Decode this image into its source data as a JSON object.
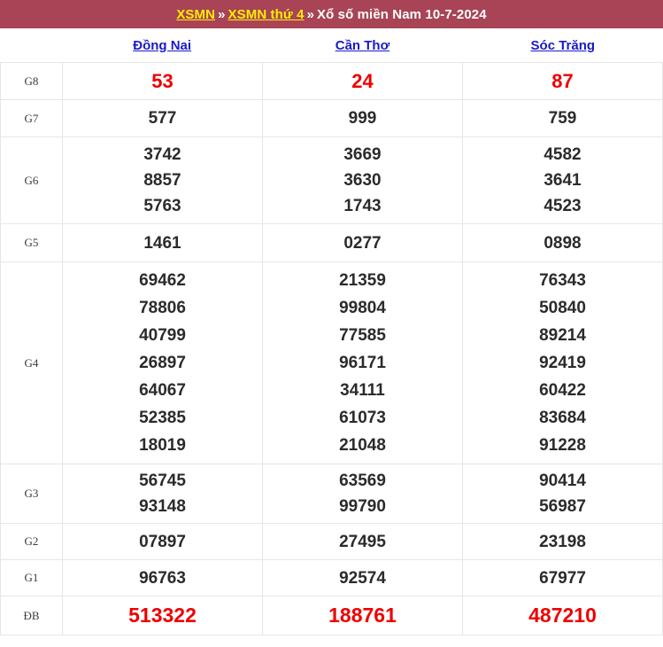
{
  "header": {
    "breadcrumb": [
      {
        "text": "XSMN",
        "type": "link"
      },
      {
        "text": "»",
        "type": "separator"
      },
      {
        "text": "XSMN thứ 4",
        "type": "link"
      },
      {
        "text": "»",
        "type": "separator"
      },
      {
        "text": "Xổ số miền Nam 10-7-2024",
        "type": "plain"
      }
    ],
    "link1": "XSMN",
    "sep1": "»",
    "link2": "XSMN thứ 4",
    "sep2": "»",
    "title": "Xổ số miền Nam 10-7-2024",
    "background_color": "#a84455",
    "link_color": "#ffee00",
    "text_color": "#ffffff"
  },
  "columns": [
    {
      "name": "Đồng Nai",
      "link_color": "#1a1ac8"
    },
    {
      "name": "Cần Thơ",
      "link_color": "#1a1ac8"
    },
    {
      "name": "Sóc Trăng",
      "link_color": "#1a1ac8"
    }
  ],
  "column_labels": {
    "c0": "Đồng Nai",
    "c1": "Cần Thơ",
    "c2": "Sóc Trăng"
  },
  "prize_rows": [
    {
      "label": "G8",
      "highlight": true,
      "color": "#ee0000",
      "dong_nai": [
        "53"
      ],
      "can_tho": [
        "24"
      ],
      "soc_trang": [
        "87"
      ]
    },
    {
      "label": "G7",
      "highlight": false,
      "dong_nai": [
        "577"
      ],
      "can_tho": [
        "999"
      ],
      "soc_trang": [
        "759"
      ]
    },
    {
      "label": "G6",
      "highlight": false,
      "dong_nai": [
        "3742",
        "8857",
        "5763"
      ],
      "can_tho": [
        "3669",
        "3630",
        "1743"
      ],
      "soc_trang": [
        "4582",
        "3641",
        "4523"
      ]
    },
    {
      "label": "G5",
      "highlight": false,
      "dong_nai": [
        "1461"
      ],
      "can_tho": [
        "0277"
      ],
      "soc_trang": [
        "0898"
      ]
    },
    {
      "label": "G4",
      "highlight": false,
      "dong_nai": [
        "69462",
        "78806",
        "40799",
        "26897",
        "64067",
        "52385",
        "18019"
      ],
      "can_tho": [
        "21359",
        "99804",
        "77585",
        "96171",
        "34111",
        "61073",
        "21048"
      ],
      "soc_trang": [
        "76343",
        "50840",
        "89214",
        "92419",
        "60422",
        "83684",
        "91228"
      ]
    },
    {
      "label": "G3",
      "highlight": false,
      "dong_nai": [
        "56745",
        "93148"
      ],
      "can_tho": [
        "63569",
        "99790"
      ],
      "soc_trang": [
        "90414",
        "56987"
      ]
    },
    {
      "label": "G2",
      "highlight": false,
      "dong_nai": [
        "07897"
      ],
      "can_tho": [
        "27495"
      ],
      "soc_trang": [
        "23198"
      ]
    },
    {
      "label": "G1",
      "highlight": false,
      "dong_nai": [
        "96763"
      ],
      "can_tho": [
        "92574"
      ],
      "soc_trang": [
        "67977"
      ]
    },
    {
      "label": "ĐB",
      "highlight": true,
      "color": "#ee0000",
      "dong_nai": [
        "513322"
      ],
      "can_tho": [
        "188761"
      ],
      "soc_trang": [
        "487210"
      ]
    }
  ],
  "cells": {
    "g8": {
      "label": "G8",
      "c0": "53",
      "c1": "24",
      "c2": "87"
    },
    "g7": {
      "label": "G7",
      "c0": "577",
      "c1": "999",
      "c2": "759"
    },
    "g6": {
      "label": "G6",
      "c0_0": "3742",
      "c0_1": "8857",
      "c0_2": "5763",
      "c1_0": "3669",
      "c1_1": "3630",
      "c1_2": "1743",
      "c2_0": "4582",
      "c2_1": "3641",
      "c2_2": "4523"
    },
    "g5": {
      "label": "G5",
      "c0": "1461",
      "c1": "0277",
      "c2": "0898"
    },
    "g4": {
      "label": "G4",
      "c0_0": "69462",
      "c0_1": "78806",
      "c0_2": "40799",
      "c0_3": "26897",
      "c0_4": "64067",
      "c0_5": "52385",
      "c0_6": "18019",
      "c1_0": "21359",
      "c1_1": "99804",
      "c1_2": "77585",
      "c1_3": "96171",
      "c1_4": "34111",
      "c1_5": "61073",
      "c1_6": "21048",
      "c2_0": "76343",
      "c2_1": "50840",
      "c2_2": "89214",
      "c2_3": "92419",
      "c2_4": "60422",
      "c2_5": "83684",
      "c2_6": "91228"
    },
    "g3": {
      "label": "G3",
      "c0_0": "56745",
      "c0_1": "93148",
      "c1_0": "63569",
      "c1_1": "99790",
      "c2_0": "90414",
      "c2_1": "56987"
    },
    "g2": {
      "label": "G2",
      "c0": "07897",
      "c1": "27495",
      "c2": "23198"
    },
    "g1": {
      "label": "G1",
      "c0": "96763",
      "c1": "92574",
      "c2": "67977"
    },
    "db": {
      "label": "ĐB",
      "c0": "513322",
      "c1": "188761",
      "c2": "487210"
    }
  }
}
